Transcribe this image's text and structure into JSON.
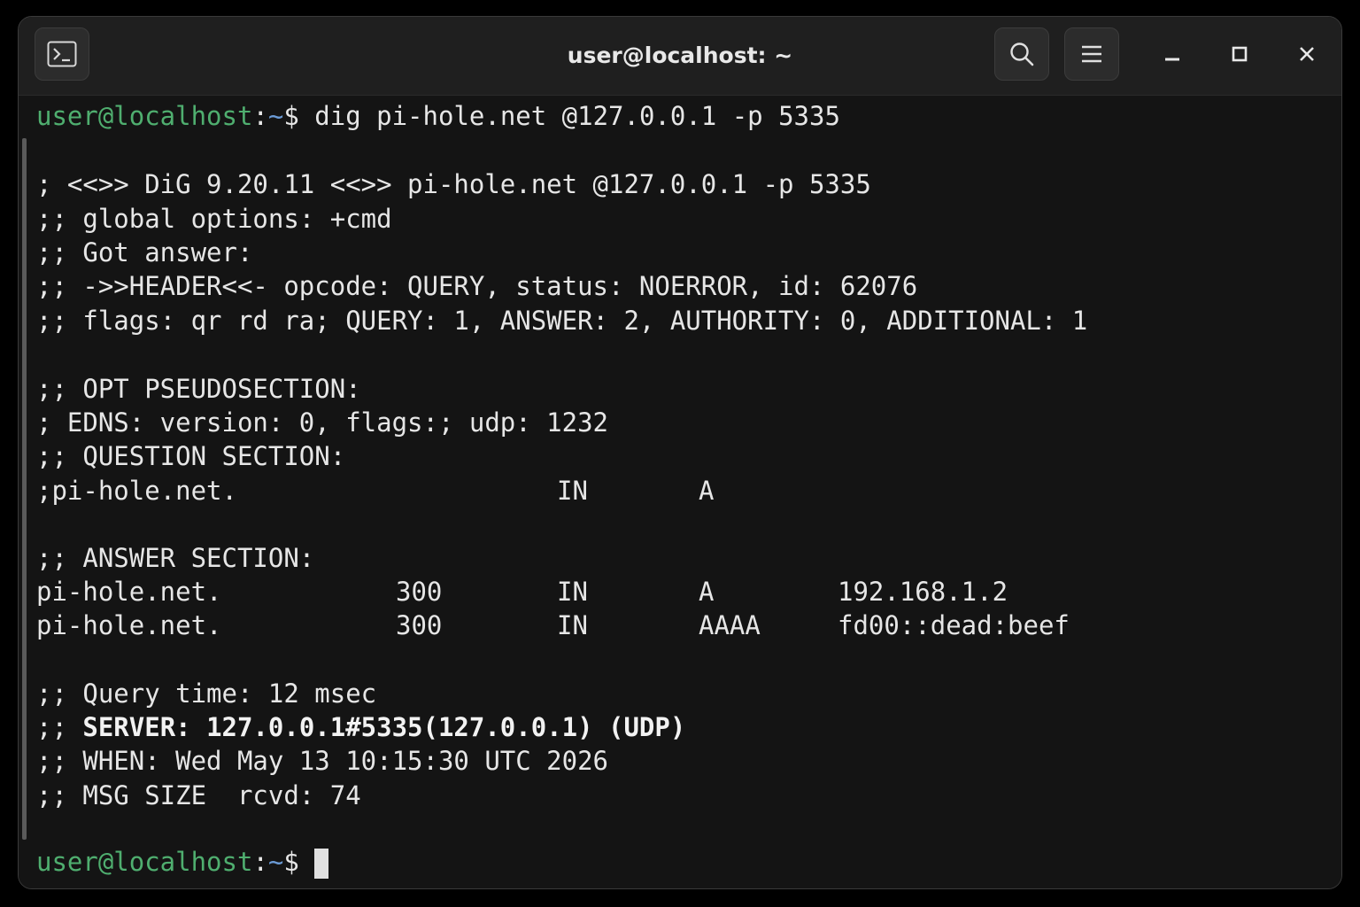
{
  "window": {
    "title": "user@localhost: ~"
  },
  "icons": {
    "terminal": "terminal-icon",
    "search": "search-icon",
    "menu": "hamburger-menu-icon",
    "minimize": "minimize-icon",
    "maximize": "maximize-icon",
    "close": "close-icon"
  },
  "colors": {
    "user": "#4fae6f",
    "path": "#6b9bd6",
    "text": "#e6e6e6",
    "background": "#141414"
  },
  "prompt": {
    "user": "user@localhost",
    "sep": ":",
    "path": "~",
    "symbol": "$"
  },
  "command": " dig pi-hole.net @127.0.0.1 -p 5335",
  "output": {
    "banner": "; <<>> DiG 9.20.11 <<>> pi-hole.net @127.0.0.1 -p 5335",
    "global_options": ";; global options: +cmd",
    "got_answer": ";; Got answer:",
    "header": ";; ->>HEADER<<- opcode: QUERY, status: NOERROR, id: 62076",
    "flags": ";; flags: qr rd ra; QUERY: 1, ANSWER: 2, AUTHORITY: 0, ADDITIONAL: 1",
    "opt_title": ";; OPT PSEUDOSECTION:",
    "edns": "; EDNS: version: 0, flags:; udp: 1232",
    "question_title": ";; QUESTION SECTION:",
    "question": {
      "name": ";pi-hole.net.",
      "class": "IN",
      "type": "A"
    },
    "answer_title": ";; ANSWER SECTION:",
    "answers": [
      {
        "name": "pi-hole.net.",
        "ttl": "300",
        "class": "IN",
        "type": "A",
        "data": "192.168.1.2"
      },
      {
        "name": "pi-hole.net.",
        "ttl": "300",
        "class": "IN",
        "type": "AAAA",
        "data": "fd00::dead:beef"
      }
    ],
    "query_time": ";; Query time: 12 msec",
    "server_prefix": ";; ",
    "server": "SERVER: 127.0.0.1#5335(127.0.0.1) (UDP)",
    "when": ";; WHEN: Wed May 13 10:15:30 UTC 2026",
    "msg_size": ";; MSG SIZE  rcvd: 74"
  }
}
